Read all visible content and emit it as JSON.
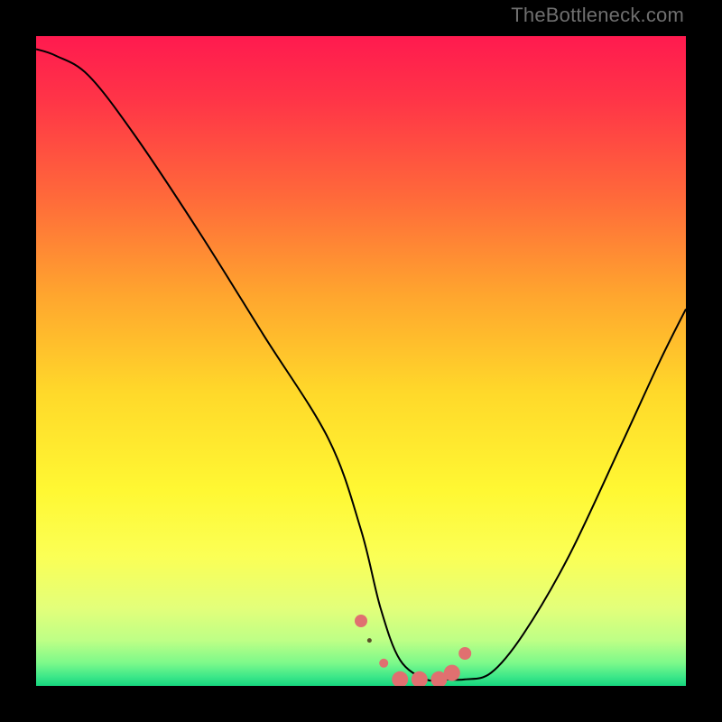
{
  "watermark": "TheBottleneck.com",
  "colors": {
    "bg": "#000000",
    "curve": "#000000",
    "marker": "#e07070",
    "marker_dark": "#5a5028"
  },
  "chart_data": {
    "type": "line",
    "title": "",
    "xlabel": "",
    "ylabel": "",
    "xlim": [
      0,
      100
    ],
    "ylim": [
      0,
      100
    ],
    "gradient_stops": [
      {
        "offset": 0.0,
        "color": "#ff1a4f"
      },
      {
        "offset": 0.1,
        "color": "#ff3547"
      },
      {
        "offset": 0.25,
        "color": "#ff6a3a"
      },
      {
        "offset": 0.4,
        "color": "#ffa62e"
      },
      {
        "offset": 0.55,
        "color": "#ffd92a"
      },
      {
        "offset": 0.7,
        "color": "#fff833"
      },
      {
        "offset": 0.8,
        "color": "#fbff55"
      },
      {
        "offset": 0.88,
        "color": "#e3ff7a"
      },
      {
        "offset": 0.93,
        "color": "#beff86"
      },
      {
        "offset": 0.965,
        "color": "#7cf98a"
      },
      {
        "offset": 0.985,
        "color": "#3fe889"
      },
      {
        "offset": 1.0,
        "color": "#16d67f"
      }
    ],
    "series": [
      {
        "name": "bottleneck-curve",
        "x": [
          0,
          3,
          8,
          15,
          25,
          35,
          45,
          50,
          53,
          56,
          60,
          63,
          66,
          70,
          75,
          82,
          90,
          96,
          100
        ],
        "values": [
          98,
          97,
          94,
          85,
          70,
          54,
          38,
          24,
          12,
          4,
          1,
          1,
          1,
          2,
          8,
          20,
          37,
          50,
          58
        ]
      }
    ],
    "highlight_points": {
      "x": [
        50,
        53.5,
        56,
        59,
        62,
        64,
        66
      ],
      "values": [
        10,
        3.5,
        1,
        1,
        1,
        2,
        5
      ],
      "size": [
        7,
        5,
        9,
        9,
        9,
        9,
        7
      ]
    }
  }
}
